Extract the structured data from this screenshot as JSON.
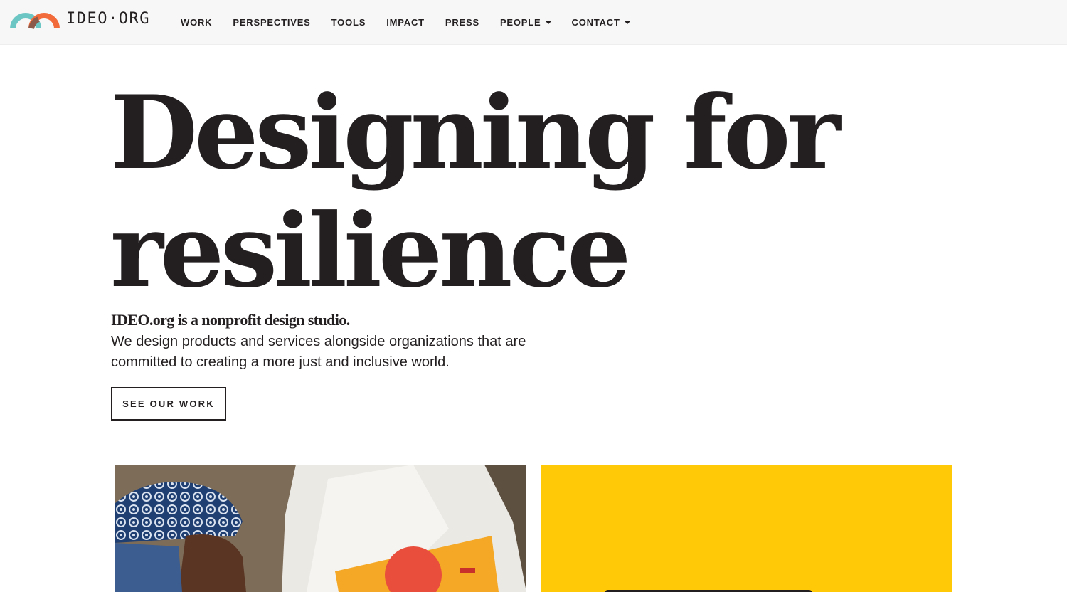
{
  "brand": {
    "name": "IDEO·ORG",
    "logo_icon": "rainbow-arch-logo",
    "colors": {
      "teal": "#6cc6c4",
      "orange": "#f26b3a",
      "dark": "#231f20"
    }
  },
  "nav": {
    "items": [
      {
        "label": "WORK",
        "dropdown": false
      },
      {
        "label": "PERSPECTIVES",
        "dropdown": false
      },
      {
        "label": "TOOLS",
        "dropdown": false
      },
      {
        "label": "IMPACT",
        "dropdown": false
      },
      {
        "label": "PRESS",
        "dropdown": false
      },
      {
        "label": "PEOPLE",
        "dropdown": true
      },
      {
        "label": "CONTACT",
        "dropdown": true
      }
    ]
  },
  "hero": {
    "title_line1": "Designing for",
    "title_line2": "resilience",
    "intro_strong": "IDEO.org is a nonprofit design studio.",
    "intro_body": "We design products and services alongside organizations that are committed to creating a more just and inclusive world.",
    "cta_label": "SEE OUR WORK"
  },
  "cards": {
    "photo": {
      "description_icon": "photo-woman-with-flyer"
    },
    "yellow": {
      "color": "#ffc907"
    }
  }
}
